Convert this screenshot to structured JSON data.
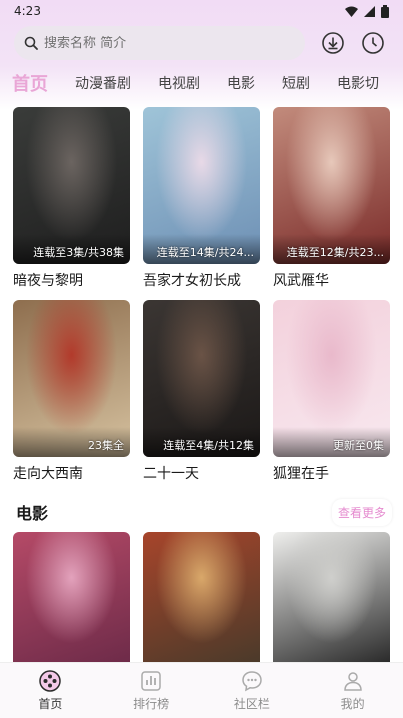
{
  "status_bar": {
    "time": "4:23"
  },
  "search": {
    "placeholder": "搜索名称 简介"
  },
  "tabs": [
    "首页",
    "动漫番剧",
    "电视剧",
    "电影",
    "短剧",
    "电影切"
  ],
  "tv_items": [
    {
      "title": "暗夜与黎明",
      "badge": "连载至3集/共38集",
      "colors": [
        "#3a3c3a",
        "#6b6460",
        "#1e1e1e"
      ]
    },
    {
      "title": "吾家才女初长成",
      "badge": "连载至14集/共24...",
      "colors": [
        "#9fc4d8",
        "#e8d9e7",
        "#6d8fb4"
      ]
    },
    {
      "title": "风武雁华",
      "badge": "连载至12集/共23...",
      "colors": [
        "#c28b7c",
        "#e7c8ba",
        "#7a2b29"
      ]
    },
    {
      "title": "走向大西南",
      "badge": "23集全",
      "colors": [
        "#8e6e4e",
        "#b23a2b",
        "#d6c2a0"
      ]
    },
    {
      "title": "二十一天",
      "badge": "连载至4集/共12集",
      "colors": [
        "#3b3633",
        "#6a5346",
        "#1b1817"
      ]
    },
    {
      "title": "狐狸在手",
      "badge": "更新至0集",
      "colors": [
        "#f3d1dc",
        "#e9b9cb",
        "#f8e8ef"
      ]
    }
  ],
  "movie_section": {
    "title": "电影",
    "more": "查看更多"
  },
  "movie_items": [
    {
      "colors": [
        "#b54a67",
        "#e3a2bc",
        "#6e2b49"
      ]
    },
    {
      "colors": [
        "#a7452b",
        "#d9a86a",
        "#4b3a2a"
      ]
    },
    {
      "colors": [
        "#efefed",
        "#cfcfcc",
        "#2b2b2b"
      ]
    }
  ],
  "bottom_nav": [
    {
      "label": "首页",
      "icon": "film-reel-icon"
    },
    {
      "label": "排行榜",
      "icon": "bar-chart-icon"
    },
    {
      "label": "社区栏",
      "icon": "chat-bubble-icon"
    },
    {
      "label": "我的",
      "icon": "user-icon"
    }
  ],
  "colors": {
    "accent": "#e9a6d6",
    "more_text": "#e58bcf"
  }
}
